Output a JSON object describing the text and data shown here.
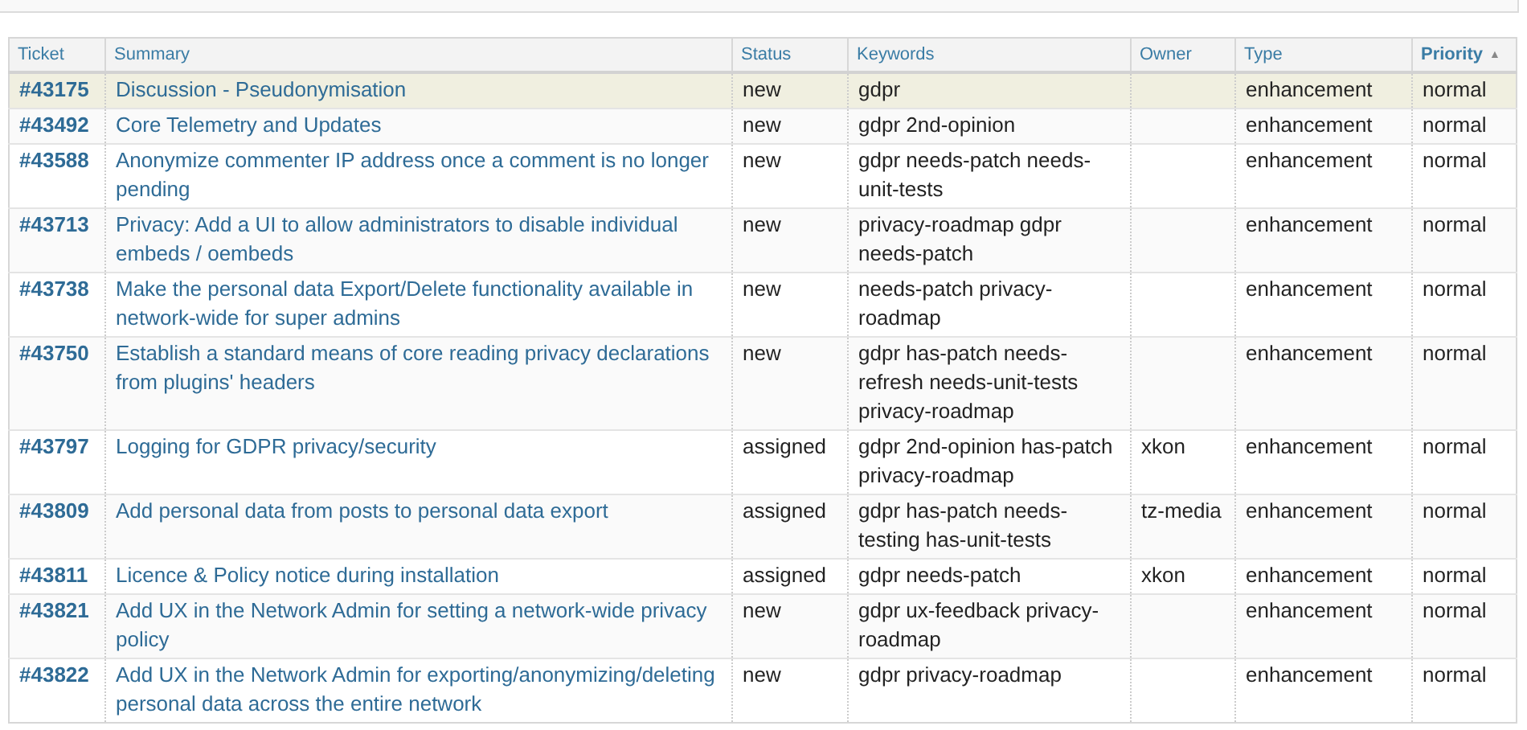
{
  "table": {
    "columns": [
      {
        "label": "Ticket",
        "sorted": false
      },
      {
        "label": "Summary",
        "sorted": false
      },
      {
        "label": "Status",
        "sorted": false
      },
      {
        "label": "Keywords",
        "sorted": false
      },
      {
        "label": "Owner",
        "sorted": false
      },
      {
        "label": "Type",
        "sorted": false
      },
      {
        "label": "Priority",
        "sorted": true,
        "sort_indicator": "▲"
      }
    ],
    "rows": [
      {
        "selected": true,
        "ticket": "#43175",
        "summary": "Discussion - Pseudonymisation",
        "status": "new",
        "keywords": "gdpr",
        "owner": "",
        "type": "enhancement",
        "priority": "normal"
      },
      {
        "selected": false,
        "ticket": "#43492",
        "summary": "Core Telemetry and Updates",
        "status": "new",
        "keywords": "gdpr 2nd-opinion",
        "owner": "",
        "type": "enhancement",
        "priority": "normal"
      },
      {
        "selected": false,
        "ticket": "#43588",
        "summary": "Anonymize commenter IP address once a comment is no longer pending",
        "status": "new",
        "keywords": "gdpr needs-patch needs-unit-tests",
        "owner": "",
        "type": "enhancement",
        "priority": "normal"
      },
      {
        "selected": false,
        "ticket": "#43713",
        "summary": "Privacy: Add a UI to allow administrators to disable individual embeds / oembeds",
        "status": "new",
        "keywords": "privacy-roadmap gdpr needs-patch",
        "owner": "",
        "type": "enhancement",
        "priority": "normal"
      },
      {
        "selected": false,
        "ticket": "#43738",
        "summary": "Make the personal data Export/Delete functionality available in network-wide for super admins",
        "status": "new",
        "keywords": "needs-patch privacy-roadmap",
        "owner": "",
        "type": "enhancement",
        "priority": "normal"
      },
      {
        "selected": false,
        "ticket": "#43750",
        "summary": "Establish a standard means of core reading privacy declarations from plugins' headers",
        "status": "new",
        "keywords": "gdpr has-patch needs-refresh needs-unit-tests privacy-roadmap",
        "owner": "",
        "type": "enhancement",
        "priority": "normal"
      },
      {
        "selected": false,
        "ticket": "#43797",
        "summary": "Logging for GDPR privacy/security",
        "status": "assigned",
        "keywords": "gdpr 2nd-opinion has-patch privacy-roadmap",
        "owner": "xkon",
        "type": "enhancement",
        "priority": "normal"
      },
      {
        "selected": false,
        "ticket": "#43809",
        "summary": "Add personal data from posts to personal data export",
        "status": "assigned",
        "keywords": "gdpr has-patch needs-testing has-unit-tests",
        "owner": "tz-media",
        "type": "enhancement",
        "priority": "normal"
      },
      {
        "selected": false,
        "ticket": "#43811",
        "summary": "Licence & Policy notice during installation",
        "status": "assigned",
        "keywords": "gdpr needs-patch",
        "owner": "xkon",
        "type": "enhancement",
        "priority": "normal"
      },
      {
        "selected": false,
        "ticket": "#43821",
        "summary": "Add UX in the Network Admin for setting a network-wide privacy policy",
        "status": "new",
        "keywords": "gdpr ux-feedback privacy-roadmap",
        "owner": "",
        "type": "enhancement",
        "priority": "normal"
      },
      {
        "selected": false,
        "ticket": "#43822",
        "summary": "Add UX in the Network Admin for exporting/anonymizing/deleting personal data across the entire network",
        "status": "new",
        "keywords": "gdpr privacy-roadmap",
        "owner": "",
        "type": "enhancement",
        "priority": "normal"
      }
    ]
  }
}
